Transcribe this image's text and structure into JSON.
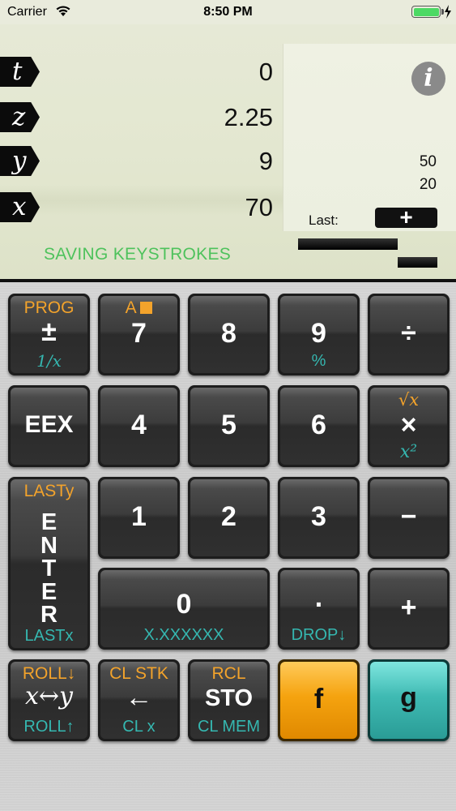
{
  "status_bar": {
    "carrier": "Carrier",
    "time": "8:50 PM",
    "battery_level": 1.0
  },
  "display": {
    "stack": [
      {
        "register": "t",
        "value": "0"
      },
      {
        "register": "z",
        "value": "2.25"
      },
      {
        "register": "y",
        "value": "9"
      },
      {
        "register": "x",
        "value": "70"
      }
    ],
    "info_button": "i",
    "program_lines": [
      "50",
      "20"
    ],
    "last_label": "Last:",
    "last_op": "+",
    "message": "SAVING KEYSTROKES",
    "colors": {
      "message": "#4ec25c",
      "f_shift": "#f3a32b",
      "g_shift": "#35b7b0"
    }
  },
  "keys": {
    "chs": {
      "f": "PROG",
      "main": "±",
      "g": "1/x"
    },
    "k7": {
      "f": "A",
      "main": "7"
    },
    "k8": {
      "main": "8"
    },
    "k9": {
      "main": "9",
      "g": "%"
    },
    "div": {
      "main": "÷"
    },
    "eex": {
      "main": "EEX"
    },
    "k4": {
      "main": "4"
    },
    "k5": {
      "main": "5"
    },
    "k6": {
      "main": "6"
    },
    "mul": {
      "f": "√x",
      "main": "×",
      "g": "x²"
    },
    "enter": {
      "f": "LASTy",
      "letters": [
        "E",
        "N",
        "T",
        "E",
        "R"
      ],
      "g": "LASTx"
    },
    "k1": {
      "main": "1"
    },
    "k2": {
      "main": "2"
    },
    "k3": {
      "main": "3"
    },
    "sub": {
      "main": "−"
    },
    "k0": {
      "main": "0",
      "g": "X.XXXXXX"
    },
    "dot": {
      "main": ".",
      "g": "DROP↓"
    },
    "add": {
      "main": "+"
    },
    "swap": {
      "f": "ROLL↓",
      "main": "x↔y",
      "g": "ROLL↑"
    },
    "back": {
      "f": "CL STK",
      "main": "←",
      "g": "CL x"
    },
    "sto": {
      "f": "RCL",
      "main": "STO",
      "g": "CL MEM"
    },
    "fkey": {
      "main": "f"
    },
    "gkey": {
      "main": "g"
    }
  }
}
